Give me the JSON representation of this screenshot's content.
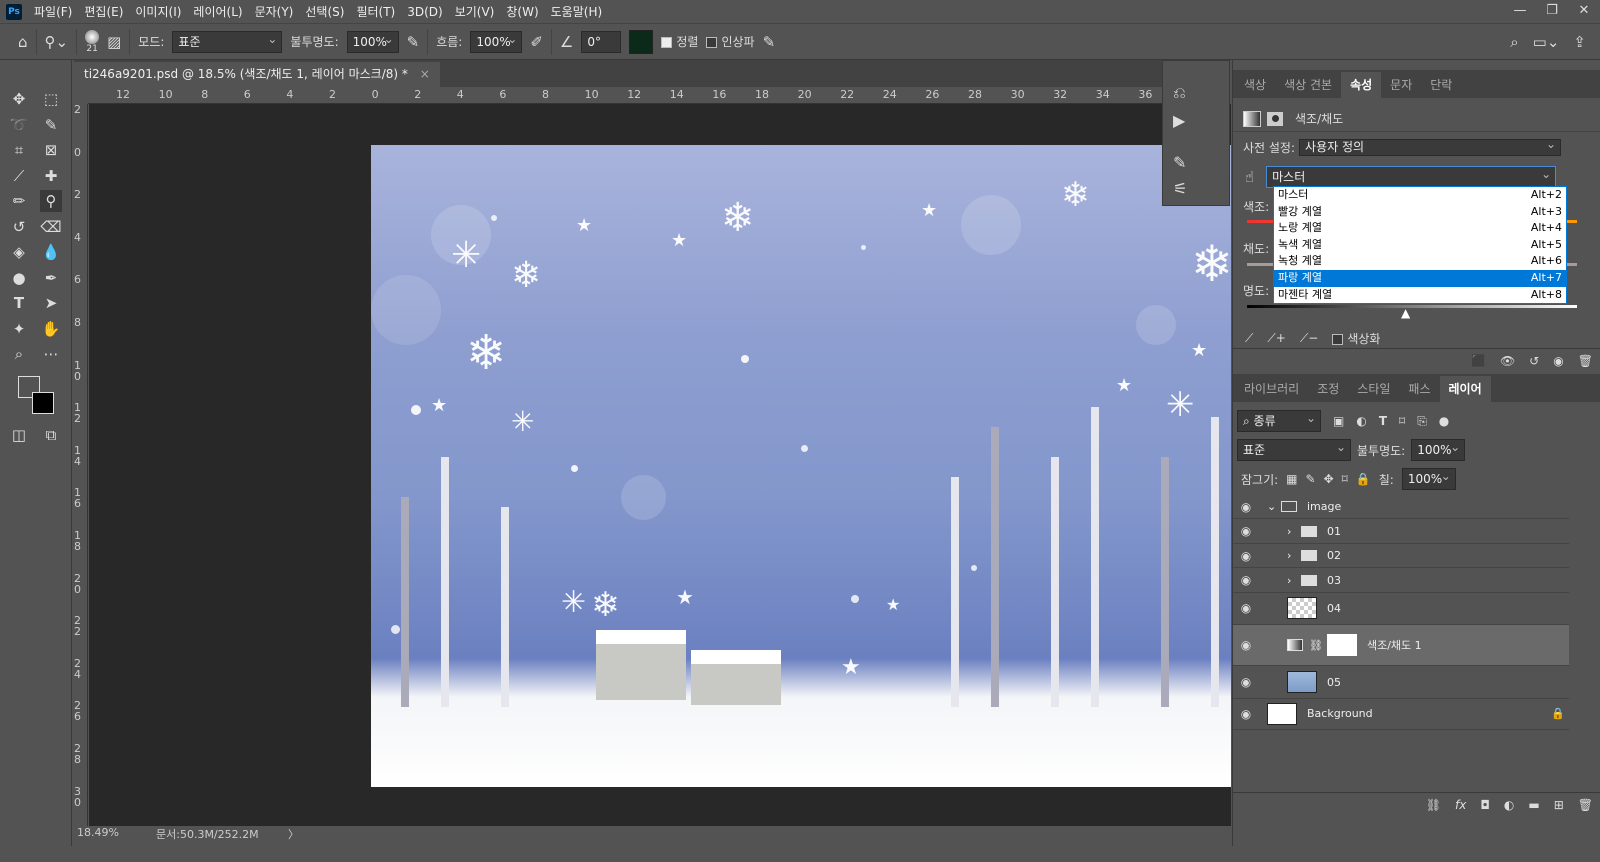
{
  "app": {
    "logo": "Ps",
    "menu": [
      "파일(F)",
      "편집(E)",
      "이미지(I)",
      "레이어(L)",
      "문자(Y)",
      "선택(S)",
      "필터(T)",
      "3D(D)",
      "보기(V)",
      "창(W)",
      "도움말(H)"
    ],
    "window_controls": [
      "—",
      "❐",
      "✕"
    ]
  },
  "options": {
    "brush_size": "21",
    "mode_label": "모드:",
    "mode_value": "표준",
    "opacity_label": "불투명도:",
    "opacity_value": "100%",
    "flow_label": "흐름:",
    "flow_value": "100%",
    "angle_value": "0°",
    "aligned_label": "정렬",
    "aligned_checked": true,
    "sample_label": "인상파",
    "sample_checked": false
  },
  "document": {
    "tab_title": "ti246a9201.psd @ 18.5% (색조/채도 1, 레이어 마스크/8) *",
    "close": "×"
  },
  "rulers": {
    "horizontal": [
      "12",
      "10",
      "8",
      "6",
      "4",
      "2",
      "0",
      "2",
      "4",
      "6",
      "8",
      "10",
      "12",
      "14",
      "16",
      "18",
      "20",
      "22",
      "24",
      "26",
      "28",
      "30",
      "32",
      "34",
      "36"
    ],
    "vertical": [
      "2",
      "0",
      "2",
      "4",
      "6",
      "8",
      "10",
      "12",
      "14",
      "16",
      "18",
      "20",
      "22",
      "24",
      "26",
      "28",
      "30"
    ]
  },
  "status": {
    "zoom": "18.49%",
    "doc_size": "문서:50.3M/252.2M",
    "arrow": "〉"
  },
  "properties": {
    "tabs": [
      "색상",
      "색상 견본",
      "속성",
      "문자",
      "단락"
    ],
    "active_tab": "속성",
    "title": "색조/채도",
    "preset_label": "사전 설정:",
    "preset_value": "사용자 정의",
    "channel_value": "마스터",
    "hue_label": "색조:",
    "sat_label": "채도:",
    "light_label": "명도:",
    "colorize_label": "색상화",
    "dropdown": [
      {
        "label": "마스터",
        "shortcut": "Alt+2"
      },
      {
        "label": "빨강 계열",
        "shortcut": "Alt+3"
      },
      {
        "label": "노랑 계열",
        "shortcut": "Alt+4"
      },
      {
        "label": "녹색 계열",
        "shortcut": "Alt+5"
      },
      {
        "label": "녹청 계열",
        "shortcut": "Alt+6"
      },
      {
        "label": "파랑 계열",
        "shortcut": "Alt+7",
        "selected": true
      },
      {
        "label": "마젠타 계열",
        "shortcut": "Alt+8"
      }
    ]
  },
  "layers_panel": {
    "tabs": [
      "라이브러리",
      "조정",
      "스타일",
      "패스",
      "레이어"
    ],
    "active_tab": "레이어",
    "filter_value": "종류",
    "blend_value": "표준",
    "opacity_label": "불투명도:",
    "opacity_value": "100%",
    "lock_label": "잠그기:",
    "fill_label": "칠:",
    "fill_value": "100%",
    "layers": [
      {
        "name": "image",
        "type": "group-open"
      },
      {
        "name": "01",
        "type": "group"
      },
      {
        "name": "02",
        "type": "group"
      },
      {
        "name": "03",
        "type": "group"
      },
      {
        "name": "04",
        "type": "pixel-transparent"
      },
      {
        "name": "색조/채도 1",
        "type": "adjustment",
        "selected": true
      },
      {
        "name": "05",
        "type": "pixel"
      },
      {
        "name": "Background",
        "type": "background",
        "locked": true
      }
    ]
  },
  "colors": {
    "accent": "#0078d7",
    "panel": "#535353",
    "workspace": "#282828"
  }
}
